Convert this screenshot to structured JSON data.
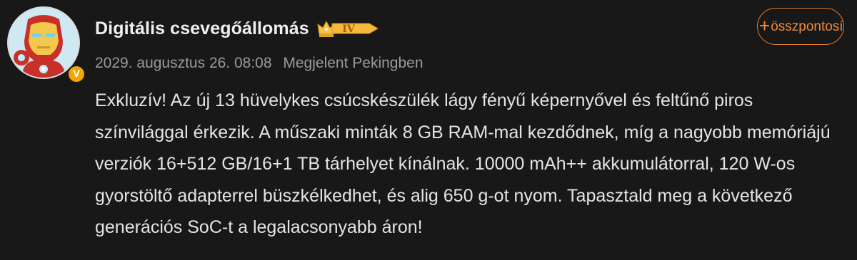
{
  "post": {
    "author": {
      "name": "Digitális csevegőállomás",
      "level_badge": "IV",
      "verified_badge": "V"
    },
    "meta": {
      "timestamp": "2029. augusztus 26. 08:08",
      "location": "Megjelent Pekingben"
    },
    "follow_button": {
      "plus": "+",
      "label": "összpontosít"
    },
    "text": "Exkluzív! Az új 13 hüvelykes csúcskészülék lágy fényű képernyővel és feltűnő piros színvilággal érkezik. A műszaki minták 8 GB RAM-mal kezdődnek, míg a nagyobb memóriájú verziók 16+512 GB/16+1 TB tárhelyet kínálnak. 10000 mAh++ akkumulátorral, 120 W-os gyorstöltő adapterrel büszkélkedhet, és alig 650 g-ot nyom. Tapasztald meg a következő generációs SoC-t a legalacsonyabb áron!"
  },
  "colors": {
    "background": "#181818",
    "accent_orange": "#f08a3a",
    "verified_gold": "#f6a400",
    "meta_gray": "#9a9a9a"
  },
  "icons": {
    "avatar": "iron-man-avatar",
    "level": "crown-icon",
    "verified": "verified-icon"
  }
}
